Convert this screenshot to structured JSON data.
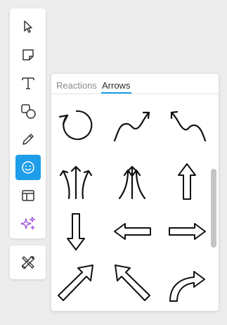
{
  "toolbar": {
    "tools": [
      {
        "name": "select-tool",
        "icon": "cursor-icon",
        "active": false
      },
      {
        "name": "sticky-note-tool",
        "icon": "sticky-note-icon",
        "active": false
      },
      {
        "name": "text-tool",
        "icon": "text-icon",
        "active": false
      },
      {
        "name": "shapes-tool",
        "icon": "shapes-icon",
        "active": false
      },
      {
        "name": "pen-tool",
        "icon": "pencil-icon",
        "active": false
      },
      {
        "name": "stickers-tool",
        "icon": "smiley-icon",
        "active": true
      },
      {
        "name": "layout-tool",
        "icon": "layout-icon",
        "active": false
      },
      {
        "name": "ai-tool",
        "icon": "sparkles-icon",
        "active": false
      }
    ],
    "secondary": [
      {
        "name": "tools-button",
        "icon": "tools-icon"
      }
    ]
  },
  "panel": {
    "tabs": [
      {
        "label": "Reactions",
        "active": false
      },
      {
        "label": "Arrows",
        "active": true
      }
    ],
    "stickers": [
      "circular-arrow-icon",
      "curvy-arrow-up-right-icon",
      "curvy-arrow-up-left-icon",
      "triple-arrows-spread-icon",
      "triple-arrows-converge-icon",
      "outline-arrow-up-icon",
      "outline-arrow-down-icon",
      "outline-arrow-left-icon",
      "outline-arrow-right-icon",
      "outline-arrow-up-right-icon",
      "outline-arrow-up-left-icon",
      "curved-arrow-right-icon"
    ]
  },
  "colors": {
    "accent": "#1e9ee8",
    "ai_purple": "#9b4fd4",
    "icon": "#333333"
  }
}
